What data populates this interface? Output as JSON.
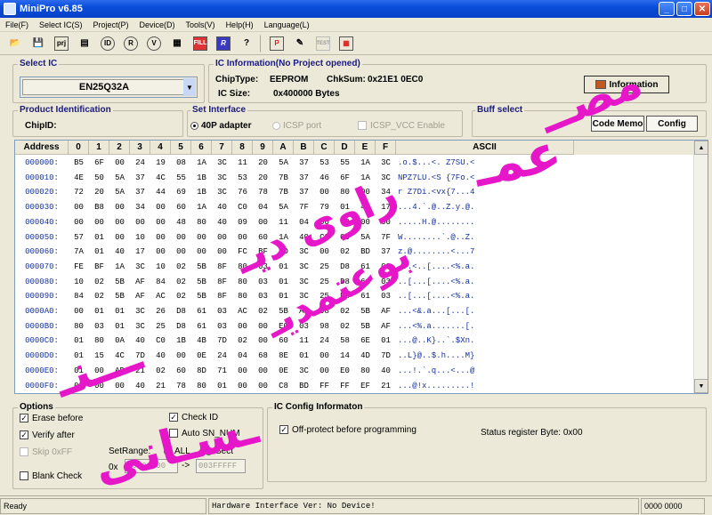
{
  "window": {
    "title": "MiniPro v6.85",
    "min": "_",
    "max": "□",
    "close": "✕"
  },
  "menu": [
    "File(F)",
    "Select IC(S)",
    "Project(P)",
    "Device(D)",
    "Tools(V)",
    "Help(H)",
    "Language(L)"
  ],
  "toolbar": {
    "icons": [
      "open-icon",
      "save-icon",
      "project-icon",
      "chip-icon",
      "read-icon",
      "verify-icon",
      "blank-icon",
      "fill-icon",
      "read-chip-icon",
      "config-icon",
      "help-icon",
      "program-icon",
      "edit-icon",
      "test-icon",
      "chip-info-icon"
    ],
    "labels": [
      "📂",
      "💾",
      "prj",
      "▤",
      "ID",
      "R",
      "V",
      "▦",
      "FILL",
      "R",
      "?",
      "P",
      "✎",
      "TEST",
      "▦"
    ]
  },
  "select_ic": {
    "label": "Select IC",
    "value": "EN25Q32A",
    "arrow": "▼"
  },
  "ic_info": {
    "label": "IC Information(No Project opened)",
    "chiptype_label": "ChipType:",
    "chiptype": "EEPROM",
    "chksum_label": "ChkSum:",
    "chksum": "0x21E1 0EC0",
    "icsize_label": "IC Size:",
    "icsize": "0x400000 Bytes",
    "info_button": "Information"
  },
  "product_id": {
    "label": "Product Identification",
    "chipid_label": "ChipID:"
  },
  "interface": {
    "label": "Set Interface",
    "opt1": "40P adapter",
    "opt2": "ICSP port",
    "opt3": "ICSP_VCC Enable"
  },
  "buff": {
    "label": "Buff select",
    "code": "Code Memo",
    "config": "Config"
  },
  "grid": {
    "headers": [
      "Address",
      "0",
      "1",
      "2",
      "3",
      "4",
      "5",
      "6",
      "7",
      "8",
      "9",
      "A",
      "B",
      "C",
      "D",
      "E",
      "F",
      "ASCII"
    ],
    "rows": [
      {
        "addr": "000000:",
        "bytes": [
          "B5",
          "6F",
          "00",
          "24",
          "19",
          "08",
          "1A",
          "3C",
          "11",
          "20",
          "5A",
          "37",
          "53",
          "55",
          "1A",
          "3C"
        ],
        "ascii": ".o.$...<. Z7SU.<"
      },
      {
        "addr": "000010:",
        "bytes": [
          "4E",
          "50",
          "5A",
          "37",
          "4C",
          "55",
          "1B",
          "3C",
          "53",
          "20",
          "7B",
          "37",
          "46",
          "6F",
          "1A",
          "3C"
        ],
        "ascii": "NPZ7LU.<S {7Fo.<"
      },
      {
        "addr": "000020:",
        "bytes": [
          "72",
          "20",
          "5A",
          "37",
          "44",
          "69",
          "1B",
          "3C",
          "76",
          "78",
          "7B",
          "37",
          "00",
          "80",
          "00",
          "34"
        ],
        "ascii": "r Z7Di.<vx{7...4"
      },
      {
        "addr": "000030:",
        "bytes": [
          "00",
          "B8",
          "00",
          "34",
          "00",
          "60",
          "1A",
          "40",
          "C0",
          "04",
          "5A",
          "7F",
          "79",
          "01",
          "40",
          "17"
        ],
        "ascii": "...4.`.@..Z.y.@."
      },
      {
        "addr": "000040:",
        "bytes": [
          "00",
          "00",
          "00",
          "00",
          "00",
          "48",
          "80",
          "40",
          "09",
          "00",
          "11",
          "04",
          "00",
          "00",
          "00",
          "00"
        ],
        "ascii": ".....H.@........"
      },
      {
        "addr": "000050:",
        "bytes": [
          "57",
          "01",
          "00",
          "10",
          "00",
          "00",
          "00",
          "00",
          "00",
          "60",
          "1A",
          "40",
          "C0",
          "00",
          "5A",
          "7F"
        ],
        "ascii": "W........`.@..Z."
      },
      {
        "addr": "000060:",
        "bytes": [
          "7A",
          "01",
          "40",
          "17",
          "00",
          "00",
          "00",
          "00",
          "FC",
          "BF",
          "1D",
          "3C",
          "00",
          "02",
          "BD",
          "37"
        ],
        "ascii": "z.@........<...7"
      },
      {
        "addr": "000070:",
        "bytes": [
          "FE",
          "BF",
          "1A",
          "3C",
          "10",
          "02",
          "5B",
          "8F",
          "80",
          "03",
          "01",
          "3C",
          "25",
          "D8",
          "61",
          "03"
        ],
        "ascii": "...<..[....<%.a."
      },
      {
        "addr": "000080:",
        "bytes": [
          "10",
          "02",
          "5B",
          "AF",
          "84",
          "02",
          "5B",
          "8F",
          "80",
          "03",
          "01",
          "3C",
          "25",
          "D8",
          "61",
          "03"
        ],
        "ascii": "..[...[....<%.a."
      },
      {
        "addr": "000090:",
        "bytes": [
          "84",
          "02",
          "5B",
          "AF",
          "AC",
          "02",
          "5B",
          "8F",
          "80",
          "03",
          "01",
          "3C",
          "25",
          "D8",
          "61",
          "03"
        ],
        "ascii": "..[...[....<%.a."
      },
      {
        "addr": "0000A0:",
        "bytes": [
          "00",
          "01",
          "01",
          "3C",
          "26",
          "D8",
          "61",
          "03",
          "AC",
          "02",
          "5B",
          "AF",
          "98",
          "02",
          "5B",
          "AF"
        ],
        "ascii": "...<&.a...[...[."
      },
      {
        "addr": "0000B0:",
        "bytes": [
          "80",
          "03",
          "01",
          "3C",
          "25",
          "D8",
          "61",
          "03",
          "00",
          "00",
          "E0",
          "03",
          "98",
          "02",
          "5B",
          "AF"
        ],
        "ascii": "...<%.a.......[."
      },
      {
        "addr": "0000C0:",
        "bytes": [
          "01",
          "80",
          "0A",
          "40",
          "C0",
          "1B",
          "4B",
          "7D",
          "02",
          "00",
          "60",
          "11",
          "24",
          "58",
          "6E",
          "01"
        ],
        "ascii": "...@..K}..`.$Xn."
      },
      {
        "addr": "0000D0:",
        "bytes": [
          "01",
          "15",
          "4C",
          "7D",
          "40",
          "00",
          "0E",
          "24",
          "04",
          "68",
          "8E",
          "01",
          "00",
          "14",
          "4D",
          "7D"
        ],
        "ascii": "..L}@..$.h....M}"
      },
      {
        "addr": "0000E0:",
        "bytes": [
          "01",
          "00",
          "AD",
          "21",
          "02",
          "60",
          "8D",
          "71",
          "00",
          "00",
          "0E",
          "3C",
          "00",
          "E0",
          "80",
          "40"
        ],
        "ascii": "...!.`.q...<...@"
      },
      {
        "addr": "0000F0:",
        "bytes": [
          "01",
          "00",
          "00",
          "40",
          "21",
          "78",
          "80",
          "01",
          "00",
          "00",
          "C8",
          "BD",
          "FF",
          "FF",
          "EF",
          "21"
        ],
        "ascii": "...@!x.........!"
      }
    ]
  },
  "options": {
    "label": "Options",
    "erase": "Erase before",
    "verify": "Verify after",
    "skip": "Skip 0xFF",
    "blank": "Blank Check",
    "check_id": "Check ID",
    "auto_sn": "Auto SN_NUM",
    "set_range": "SetRange:",
    "all": "ALL",
    "sect": "Sect",
    "prefix": "0x",
    "range_from": "00000000",
    "arrow": "->",
    "range_to": "003FFFFF"
  },
  "ic_config": {
    "label": "IC Config Informaton",
    "off_protect": "Off-protect before programming",
    "status_reg": "Status register Byte: 0x00"
  },
  "status": {
    "left": "Ready",
    "hw": "Hardware Interface Ver: No Device!",
    "right": "0000 0000"
  },
  "watermark": [
    "مصــ",
    "عمـ",
    "راوی دیـ",
    "بوعتمدیـ",
    "ـــنـ",
    "ـسـانی"
  ],
  "colors": {
    "title": "#0A4DD8",
    "face": "#ECE9D8",
    "address": "#1530A0",
    "watermark": "#E617C8"
  }
}
